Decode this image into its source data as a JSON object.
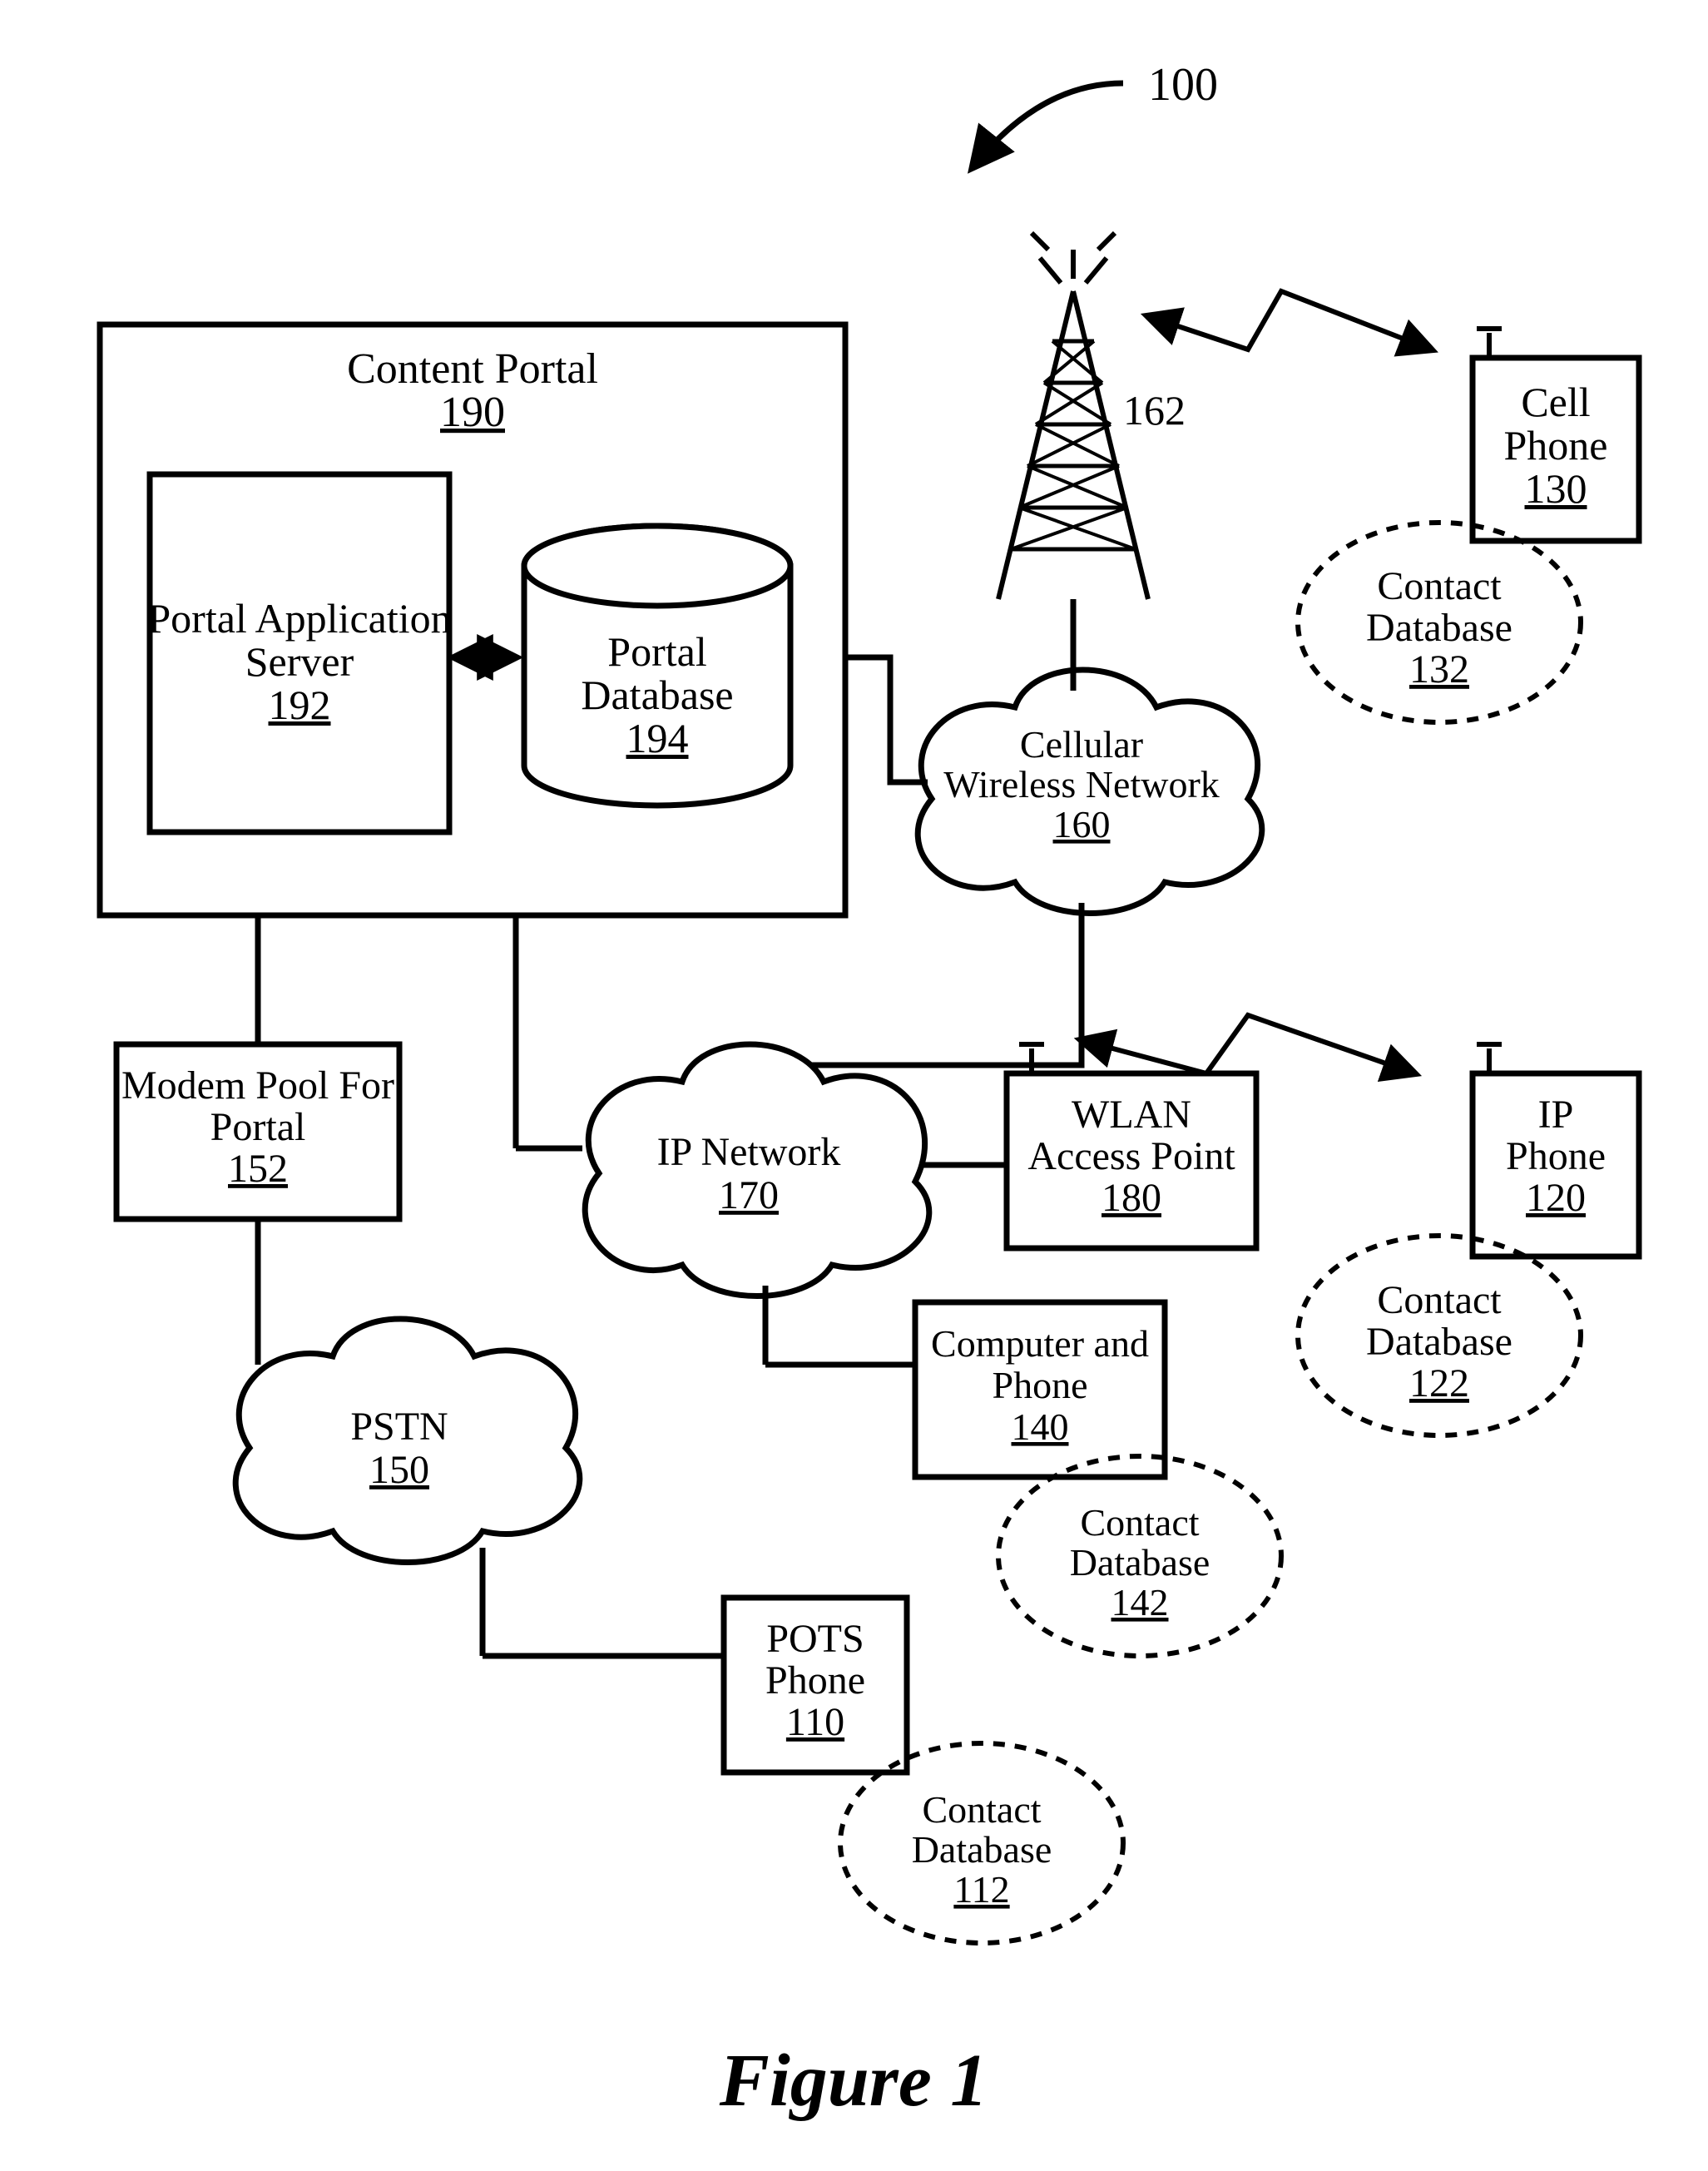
{
  "figure": {
    "number_label": "100",
    "caption": "Figure 1"
  },
  "nodes": {
    "content_portal": {
      "title": "Content Portal",
      "ref": "190"
    },
    "portal_app_server": {
      "line1": "Portal Application",
      "line2": "Server",
      "ref": "192"
    },
    "portal_database": {
      "line1": "Portal",
      "line2": "Database",
      "ref": "194"
    },
    "cell_tower": {
      "ref": "162"
    },
    "cell_phone": {
      "line1": "Cell",
      "line2": "Phone",
      "ref": "130"
    },
    "cell_phone_db": {
      "line1": "Contact",
      "line2": "Database",
      "ref": "132"
    },
    "cellular_net": {
      "line1": "Cellular",
      "line2": "Wireless Network",
      "ref": "160"
    },
    "modem_pool": {
      "line1": "Modem Pool For",
      "line2": "Portal",
      "ref": "152"
    },
    "ip_network": {
      "line1": "IP Network",
      "ref": "170"
    },
    "wlan_ap": {
      "line1": "WLAN",
      "line2": "Access Point",
      "ref": "180"
    },
    "ip_phone": {
      "line1": "IP",
      "line2": "Phone",
      "ref": "120"
    },
    "ip_phone_db": {
      "line1": "Contact",
      "line2": "Database",
      "ref": "122"
    },
    "pstn": {
      "line1": "PSTN",
      "ref": "150"
    },
    "computer_phone": {
      "line1": "Computer and",
      "line2": "Phone",
      "ref": "140"
    },
    "computer_phone_db": {
      "line1": "Contact",
      "line2": "Database",
      "ref": "142"
    },
    "pots_phone": {
      "line1": "POTS",
      "line2": "Phone",
      "ref": "110"
    },
    "pots_phone_db": {
      "line1": "Contact",
      "line2": "Database",
      "ref": "112"
    }
  }
}
